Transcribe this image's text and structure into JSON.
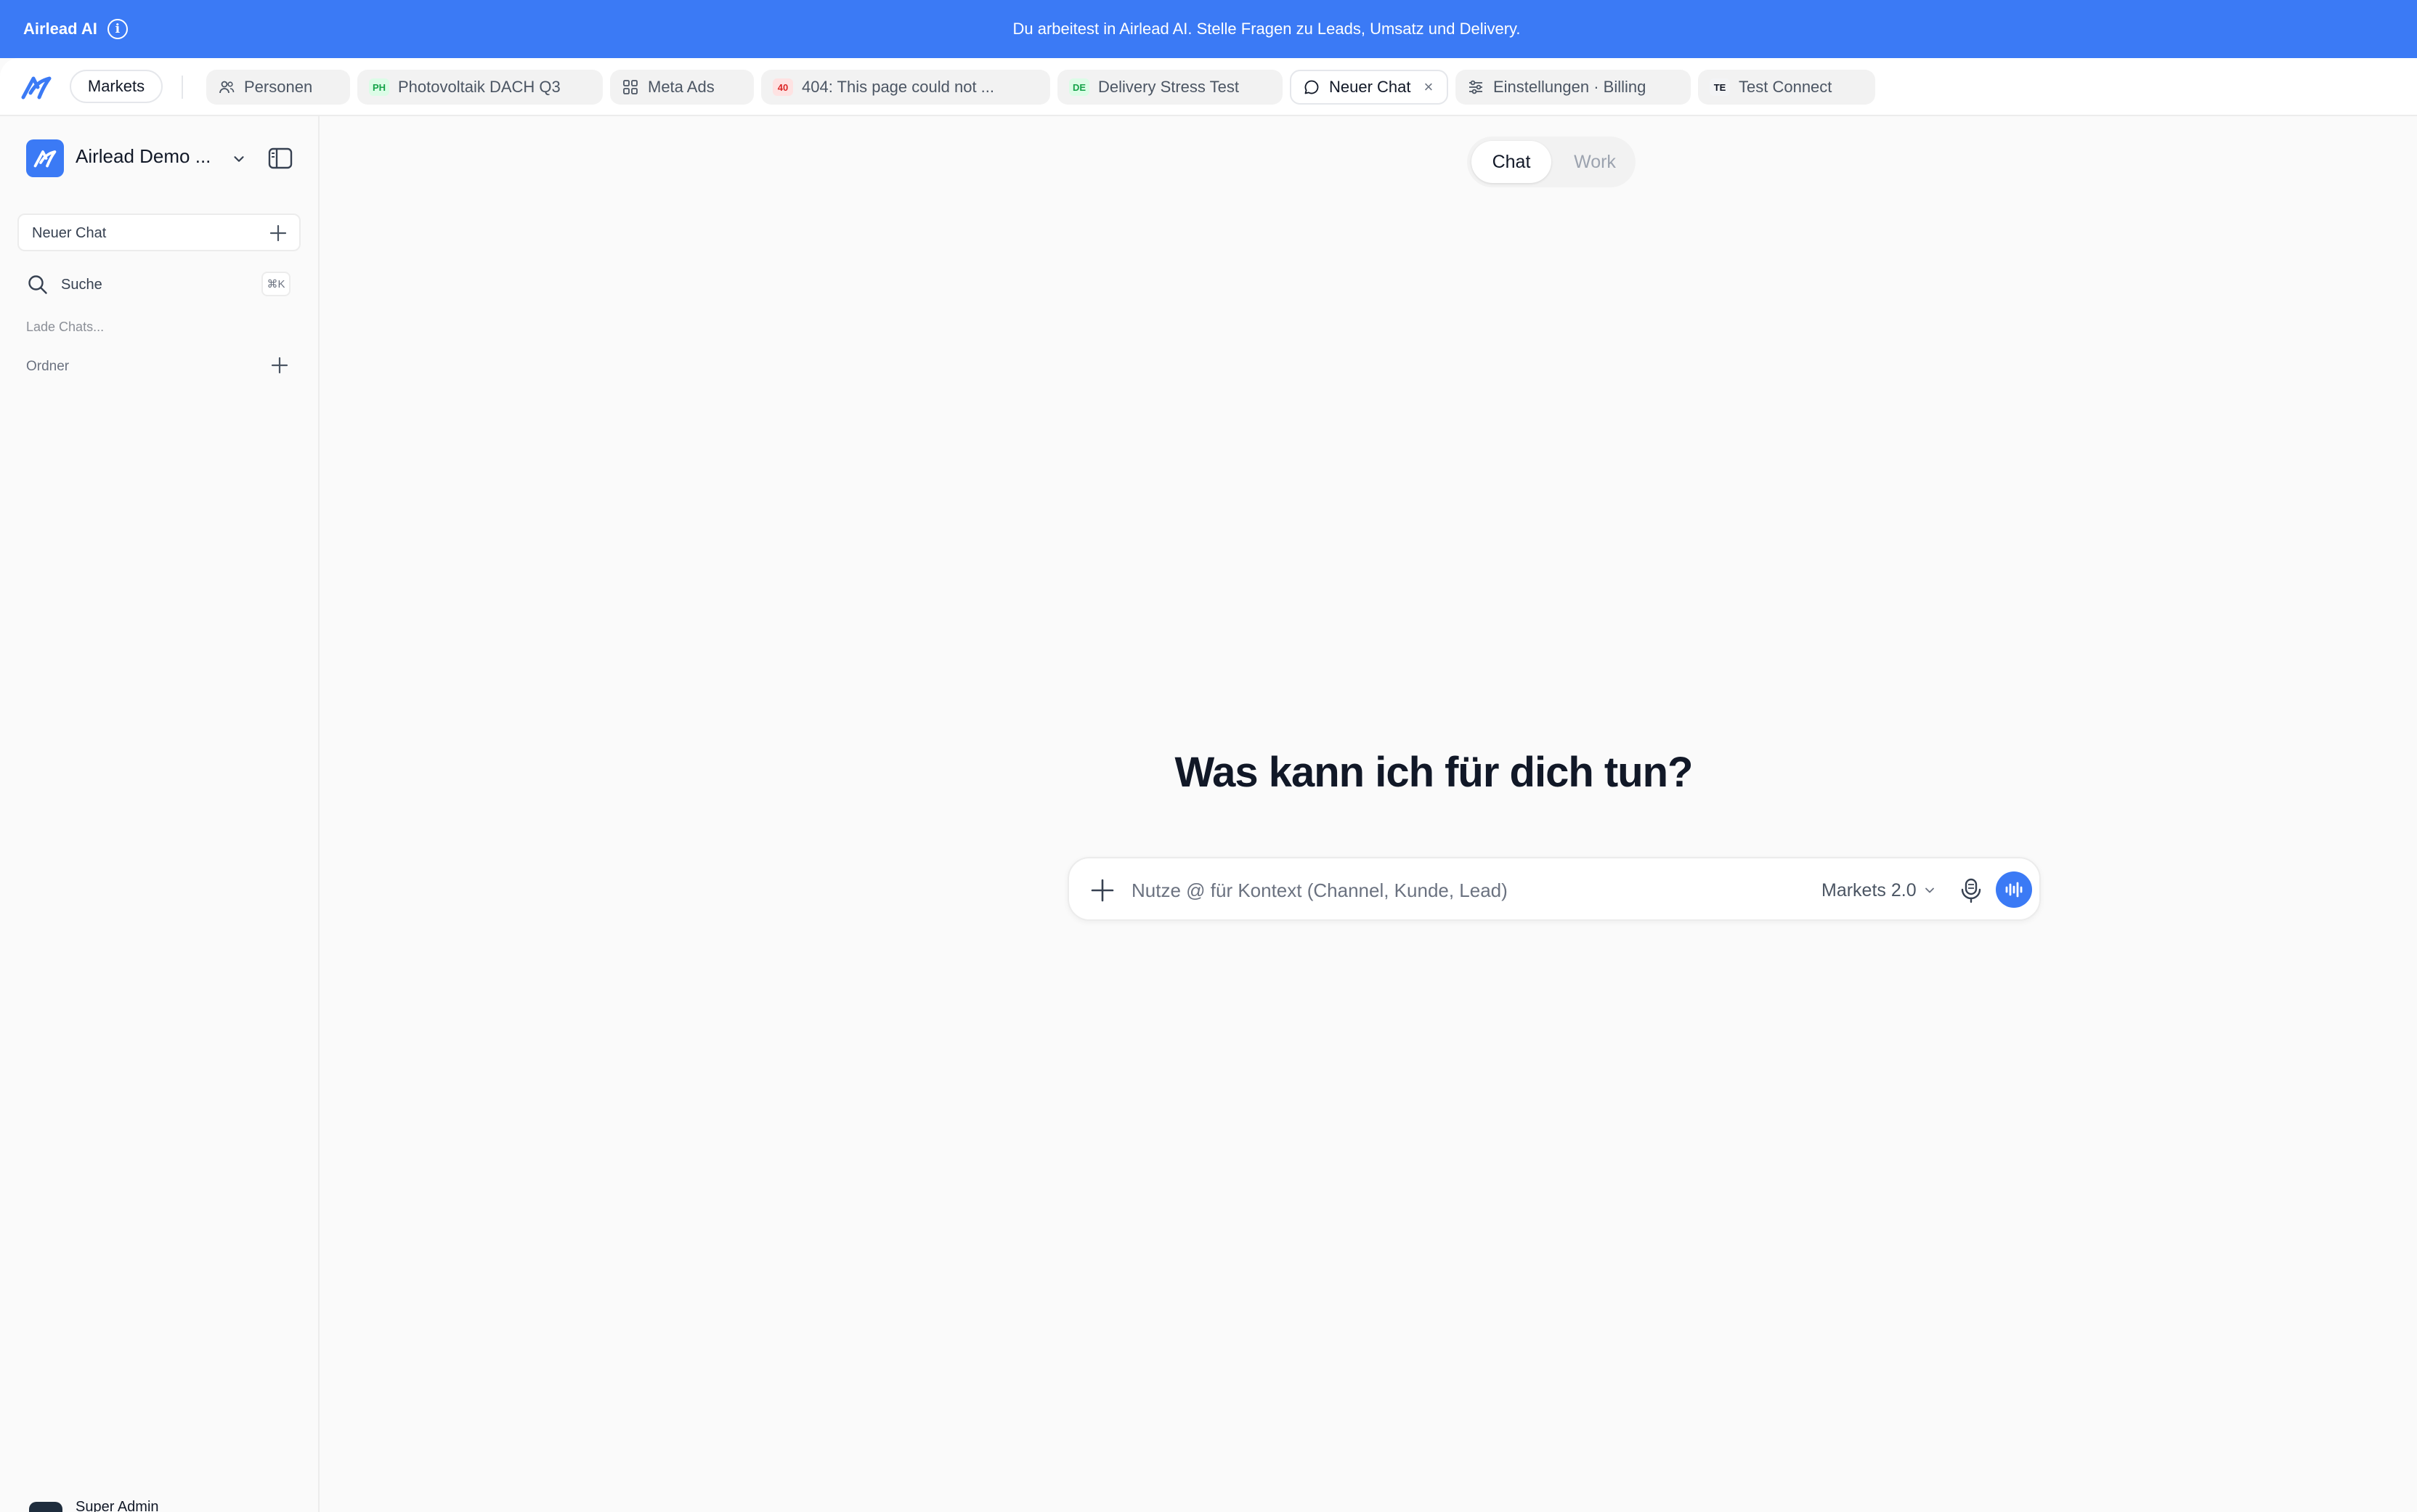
{
  "banner": {
    "brand": "Airlead AI",
    "message": "Du arbeitest in Airlead AI. Stelle Fragen zu Leads, Umsatz und Delivery."
  },
  "tabbar": {
    "markets_label": "Markets",
    "tabs": [
      {
        "label": "Personen",
        "icon": "users-icon"
      },
      {
        "label": "Photovoltaik DACH Q3",
        "badge": "PH",
        "badge_color": "#16a34a"
      },
      {
        "label": "Meta Ads",
        "icon": "grid-icon"
      },
      {
        "label": "404: This page could not ...",
        "badge": "40",
        "badge_color": "#dc2626"
      },
      {
        "label": "Delivery Stress Test",
        "badge": "DE",
        "badge_color": "#16a34a"
      },
      {
        "label": "Neuer Chat",
        "icon": "chat-bubble-icon",
        "active": true,
        "close": "×"
      },
      {
        "label": "Einstellungen · Billing",
        "icon": "sliders-icon"
      },
      {
        "label": "Test Connect",
        "badge": "TE",
        "badge_color": "#111827"
      }
    ]
  },
  "sidebar": {
    "workspace_name": "Airlead Demo ...",
    "new_chat_label": "Neuer Chat",
    "search_label": "Suche",
    "search_shortcut": "⌘K",
    "loading_text": "Lade Chats...",
    "folders_label": "Ordner",
    "user_name": "Super Admin"
  },
  "main": {
    "mode_chat": "Chat",
    "mode_work": "Work",
    "headline": "Was kann ich für dich tun?",
    "composer_placeholder": "Nutze @ für Kontext (Channel, Kunde, Lead)",
    "composer_value": "",
    "model_label": "Markets 2.0"
  },
  "colors": {
    "accent": "#3b7af5",
    "background": "#fafafa"
  }
}
